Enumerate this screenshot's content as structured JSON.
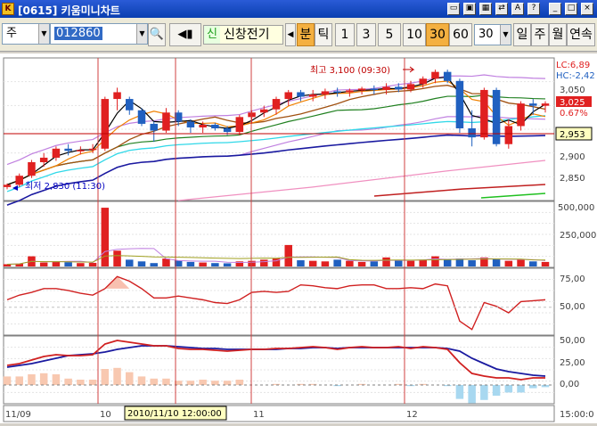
{
  "window": {
    "title": "[0615] 키움미니차트"
  },
  "toolbar": {
    "market": "주",
    "code": "012860",
    "name_badge": "신",
    "stock_name": "신창전기",
    "tab_bun": "분",
    "tab_tick": "틱",
    "intervals": [
      "1",
      "3",
      "5",
      "10",
      "30",
      "60"
    ],
    "active_interval": "30",
    "interval_value": "30",
    "periods": [
      "일",
      "주",
      "월",
      "연속"
    ]
  },
  "price_panel": {
    "high_label": "최고 3,100 (09:30)",
    "low_label": "최저 2,830 (11:30)",
    "lc": "LC:6,89",
    "hc": "HC:-2,42",
    "axis": [
      "3,050",
      "2,900",
      "2,850"
    ],
    "current": "3,025",
    "change": "0.67%",
    "crosshair": "2,953"
  },
  "volume_panel": {
    "axis": [
      "500,000",
      "250,000"
    ]
  },
  "osc_panel": {
    "axis": [
      "75,00",
      "50,00"
    ]
  },
  "macd_panel": {
    "axis": [
      "50,00",
      "25,00",
      "0,00"
    ]
  },
  "time_axis": {
    "labels": [
      "11/09",
      "10",
      "11",
      "12"
    ],
    "cursor": "2010/11/10 12:00:00",
    "right": "15:00:0"
  },
  "colors": {
    "up": "#e02020",
    "down": "#2060c0",
    "accent": "#f4b040"
  },
  "chart_data": {
    "type": "candlestick",
    "ylim": [
      2820,
      3120
    ],
    "candles": [
      [
        2840,
        2848,
        2835,
        2845
      ],
      [
        2845,
        2870,
        2840,
        2865
      ],
      [
        2865,
        2900,
        2860,
        2895
      ],
      [
        2895,
        2915,
        2885,
        2905
      ],
      [
        2905,
        2930,
        2898,
        2925
      ],
      [
        2925,
        2935,
        2910,
        2920
      ],
      [
        2920,
        2930,
        2912,
        2922
      ],
      [
        2922,
        2935,
        2915,
        2925
      ],
      [
        2925,
        3040,
        2920,
        3035
      ],
      [
        3035,
        3060,
        3010,
        3050
      ],
      [
        3035,
        3040,
        3000,
        3010
      ],
      [
        3010,
        3015,
        2975,
        2980
      ],
      [
        2980,
        2985,
        2940,
        2965
      ],
      [
        2965,
        3015,
        2960,
        3005
      ],
      [
        3005,
        3010,
        2975,
        2985
      ],
      [
        2985,
        2990,
        2960,
        2972
      ],
      [
        2972,
        2985,
        2960,
        2978
      ],
      [
        2978,
        2982,
        2965,
        2970
      ],
      [
        2970,
        2975,
        2955,
        2962
      ],
      [
        2962,
        3000,
        2955,
        2995
      ],
      [
        2995,
        3010,
        2980,
        3005
      ],
      [
        3005,
        3020,
        2995,
        3012
      ],
      [
        3012,
        3040,
        3000,
        3035
      ],
      [
        3035,
        3055,
        3020,
        3050
      ],
      [
        3050,
        3055,
        3030,
        3040
      ],
      [
        3040,
        3055,
        3030,
        3045
      ],
      [
        3045,
        3058,
        3035,
        3052
      ],
      [
        3052,
        3060,
        3040,
        3050
      ],
      [
        3050,
        3058,
        3040,
        3054
      ],
      [
        3054,
        3062,
        3045,
        3058
      ],
      [
        3058,
        3065,
        3045,
        3055
      ],
      [
        3055,
        3070,
        3045,
        3062
      ],
      [
        3062,
        3070,
        3050,
        3056
      ],
      [
        3056,
        3075,
        3050,
        3068
      ],
      [
        3068,
        3085,
        3060,
        3080
      ],
      [
        3080,
        3100,
        3070,
        3095
      ],
      [
        3095,
        3100,
        3070,
        3075
      ],
      [
        3075,
        3080,
        2960,
        2970
      ],
      [
        2970,
        3010,
        2930,
        2950
      ],
      [
        2950,
        3060,
        2945,
        3055
      ],
      [
        3055,
        3060,
        2930,
        2935
      ],
      [
        2935,
        2990,
        2925,
        2975
      ],
      [
        2975,
        3030,
        2965,
        3025
      ],
      [
        3025,
        3035,
        3000,
        3020
      ],
      [
        3020,
        3030,
        3005,
        3025
      ]
    ],
    "volume": [
      20,
      25,
      90,
      35,
      40,
      38,
      30,
      32,
      520,
      140,
      60,
      45,
      30,
      70,
      55,
      40,
      35,
      30,
      28,
      45,
      50,
      60,
      70,
      190,
      55,
      50,
      45,
      60,
      50,
      40,
      45,
      80,
      55,
      50,
      60,
      90,
      60,
      70,
      55,
      80,
      65,
      50,
      60,
      45,
      40
    ],
    "oscillator": [
      58,
      63,
      66,
      70,
      70,
      68,
      65,
      63,
      70,
      83,
      78,
      70,
      60,
      60,
      62,
      60,
      58,
      55,
      54,
      58,
      66,
      67,
      66,
      67,
      74,
      73,
      71,
      70,
      73,
      74,
      74,
      70,
      70,
      71,
      70,
      75,
      73,
      35,
      26,
      55,
      51,
      44,
      56,
      57,
      58
    ],
    "macd": [
      22,
      24,
      28,
      32,
      34,
      33,
      33,
      34,
      46,
      50,
      48,
      46,
      44,
      44,
      41,
      40,
      40,
      39,
      38,
      39,
      40,
      40,
      41,
      41,
      42,
      43,
      42,
      40,
      42,
      43,
      42,
      42,
      43,
      41,
      43,
      42,
      40,
      25,
      13,
      10,
      8,
      8,
      6,
      8,
      8
    ],
    "signal": [
      20,
      22,
      24,
      27,
      30,
      33,
      34,
      35,
      37,
      40,
      42,
      44,
      44,
      44,
      43,
      42,
      41,
      41,
      40,
      40,
      40,
      40,
      40,
      41,
      41,
      42,
      42,
      41,
      42,
      42,
      42,
      42,
      42,
      42,
      42,
      42,
      41,
      38,
      30,
      24,
      18,
      15,
      13,
      11,
      10
    ]
  }
}
